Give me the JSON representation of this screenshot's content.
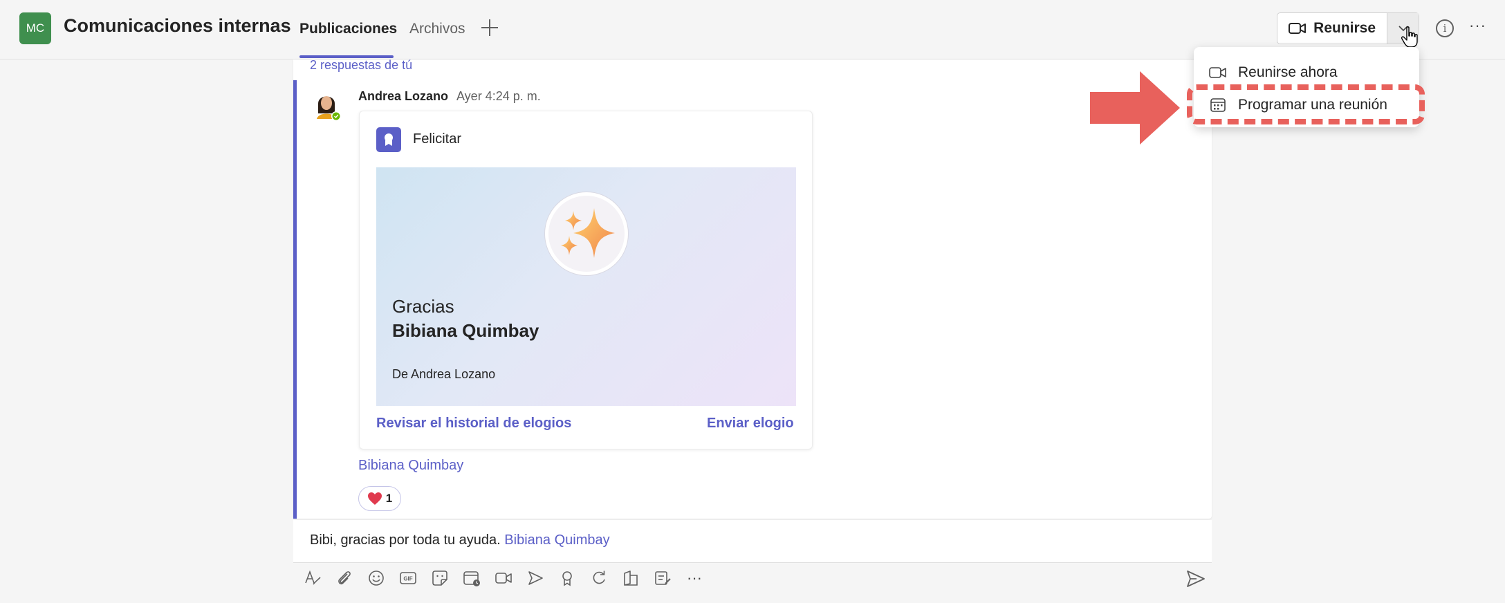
{
  "header": {
    "team_initials": "MC",
    "channel_title": "Comunicaciones internas",
    "tabs": [
      {
        "label": "Publicaciones",
        "active": true
      },
      {
        "label": "Archivos",
        "active": false
      }
    ],
    "add_tab_icon": "plus-icon",
    "join_label": "Reunirse",
    "info_icon": "info-icon",
    "more_icon": "more-icon",
    "more_glyph": "···"
  },
  "meeting_menu": {
    "items": [
      {
        "label": "Reunirse ahora",
        "icon": "video-camera-icon"
      },
      {
        "label": "Programar una reunión",
        "icon": "calendar-icon"
      }
    ]
  },
  "thread": {
    "replies_link": "2 respuestas de tú",
    "message": {
      "author": "Andrea Lozano",
      "time": "Ayer 4:24 p. m.",
      "praise": {
        "badge_label": "Felicitar",
        "word": "Gracias",
        "recipient": "Bibiana Quimbay",
        "from": "De Andrea Lozano",
        "history_link": "Revisar el historial de elogios",
        "send_link": "Enviar elogio"
      },
      "mention": "Bibiana Quimbay",
      "reaction": {
        "emoji": "heart-icon",
        "count": "1"
      }
    }
  },
  "composer": {
    "text": "Bibi, gracias por toda tu ayuda.",
    "mention": "Bibiana Quimbay",
    "toolbar_icons": [
      "format-icon",
      "attach-icon",
      "emoji-icon",
      "gif-icon",
      "sticker-icon",
      "schedule-meeting-icon",
      "video-clip-icon",
      "stream-icon",
      "praise-icon",
      "loop-icon",
      "apps-icon",
      "forms-icon",
      "more-options-icon"
    ],
    "more_glyph": "···",
    "send_icon": "send-icon"
  },
  "colors": {
    "accent": "#5b5fc7",
    "team_avatar": "#3f8f4e",
    "annotation": "#e8615c"
  }
}
